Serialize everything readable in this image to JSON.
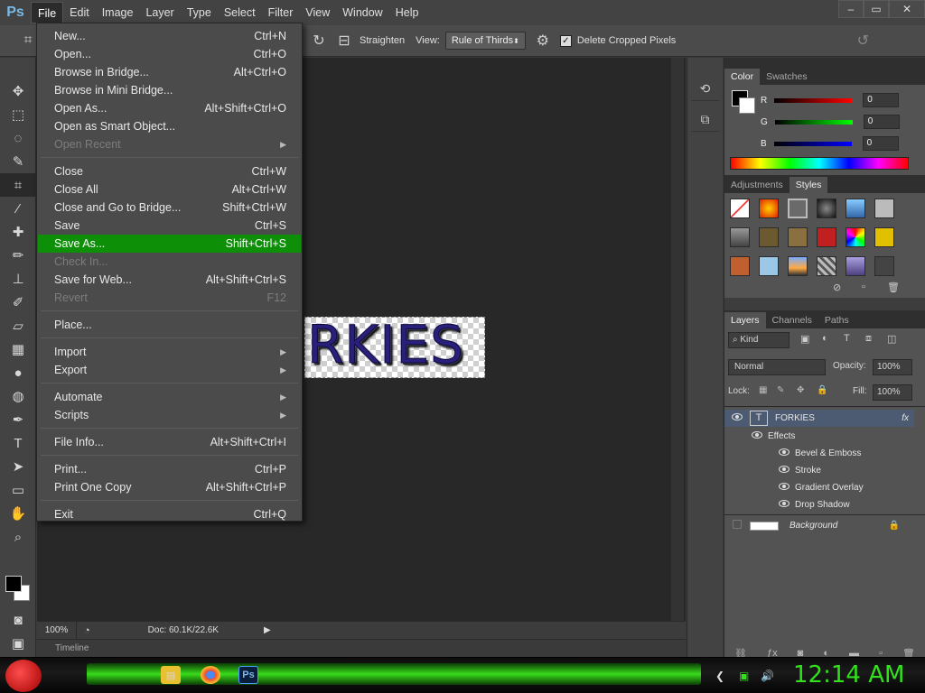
{
  "app": {
    "logo": "Ps"
  },
  "menubar": {
    "items": [
      "File",
      "Edit",
      "Image",
      "Layer",
      "Type",
      "Select",
      "Filter",
      "View",
      "Window",
      "Help"
    ],
    "open_menu": "File",
    "window_controls": [
      "–",
      "▭",
      "✕"
    ]
  },
  "options_bar": {
    "straighten_label": "Straighten",
    "view_label": "View:",
    "view_value": "Rule of Thirds",
    "delete_cropped_label": "Delete Cropped Pixels",
    "delete_cropped_checked": true
  },
  "file_menu": {
    "items": [
      {
        "label": "New...",
        "shortcut": "Ctrl+N",
        "disabled": false,
        "submenu": false
      },
      {
        "label": "Open...",
        "shortcut": "Ctrl+O",
        "disabled": false,
        "submenu": false
      },
      {
        "label": "Browse in Bridge...",
        "shortcut": "Alt+Ctrl+O",
        "disabled": false,
        "submenu": false
      },
      {
        "label": "Browse in Mini Bridge...",
        "shortcut": "",
        "disabled": false,
        "submenu": false
      },
      {
        "label": "Open As...",
        "shortcut": "Alt+Shift+Ctrl+O",
        "disabled": false,
        "submenu": false
      },
      {
        "label": "Open as Smart Object...",
        "shortcut": "",
        "disabled": false,
        "submenu": false
      },
      {
        "label": "Open Recent",
        "shortcut": "",
        "disabled": true,
        "submenu": true
      },
      {
        "label": "Close",
        "shortcut": "Ctrl+W",
        "disabled": false,
        "submenu": false
      },
      {
        "label": "Close All",
        "shortcut": "Alt+Ctrl+W",
        "disabled": false,
        "submenu": false
      },
      {
        "label": "Close and Go to Bridge...",
        "shortcut": "Shift+Ctrl+W",
        "disabled": false,
        "submenu": false
      },
      {
        "label": "Save",
        "shortcut": "Ctrl+S",
        "disabled": false,
        "submenu": false
      },
      {
        "label": "Save As...",
        "shortcut": "Shift+Ctrl+S",
        "disabled": false,
        "submenu": false,
        "highlighted": true
      },
      {
        "label": "Check In...",
        "shortcut": "",
        "disabled": true,
        "submenu": false
      },
      {
        "label": "Save for Web...",
        "shortcut": "Alt+Shift+Ctrl+S",
        "disabled": false,
        "submenu": false
      },
      {
        "label": "Revert",
        "shortcut": "F12",
        "disabled": true,
        "submenu": false
      },
      {
        "label": "Place...",
        "shortcut": "",
        "disabled": false,
        "submenu": false
      },
      {
        "label": "Import",
        "shortcut": "",
        "disabled": false,
        "submenu": true
      },
      {
        "label": "Export",
        "shortcut": "",
        "disabled": false,
        "submenu": true
      },
      {
        "label": "Automate",
        "shortcut": "",
        "disabled": false,
        "submenu": true
      },
      {
        "label": "Scripts",
        "shortcut": "",
        "disabled": false,
        "submenu": true
      },
      {
        "label": "File Info...",
        "shortcut": "Alt+Shift+Ctrl+I",
        "disabled": false,
        "submenu": false
      },
      {
        "label": "Print...",
        "shortcut": "Ctrl+P",
        "disabled": false,
        "submenu": false
      },
      {
        "label": "Print One Copy",
        "shortcut": "Alt+Shift+Ctrl+P",
        "disabled": false,
        "submenu": false
      },
      {
        "label": "Exit",
        "shortcut": "Ctrl+Q",
        "disabled": false,
        "submenu": false
      }
    ]
  },
  "canvas": {
    "text": "RKIES"
  },
  "status": {
    "zoom": "100%",
    "doc_size": "Doc: 60.1K/22.6K",
    "timeline_label": "Timeline"
  },
  "color_panel": {
    "tabs": [
      "Color",
      "Swatches"
    ],
    "channels": [
      {
        "label": "R",
        "value": "0",
        "color": "#e01010"
      },
      {
        "label": "G",
        "value": "0",
        "color": "#10c010"
      },
      {
        "label": "B",
        "value": "0",
        "color": "#1030e0"
      }
    ]
  },
  "styles_panel": {
    "tabs": [
      "Adjustments",
      "Styles"
    ],
    "active_tab": "Styles"
  },
  "layers_panel": {
    "tabs": [
      "Layers",
      "Channels",
      "Paths"
    ],
    "filter_label": "Kind",
    "blend_mode": "Normal",
    "opacity_label": "Opacity:",
    "opacity_value": "100%",
    "lock_label": "Lock:",
    "fill_label": "Fill:",
    "fill_value": "100%",
    "layers": [
      {
        "name": "FORKIES",
        "type": "text",
        "fx": "fx",
        "selected": true
      },
      {
        "name": "Effects",
        "type": "effects-header"
      },
      {
        "name": "Bevel & Emboss",
        "type": "effect"
      },
      {
        "name": "Stroke",
        "type": "effect"
      },
      {
        "name": "Gradient Overlay",
        "type": "effect"
      },
      {
        "name": "Drop Shadow",
        "type": "effect"
      },
      {
        "name": "Background",
        "type": "background",
        "locked": true
      }
    ]
  },
  "taskbar": {
    "clock": "12:14 AM"
  },
  "colors": {
    "menu_highlight": "#0d8f07",
    "clock": "#31e11c",
    "ps_blue": "#7ab8e6"
  }
}
